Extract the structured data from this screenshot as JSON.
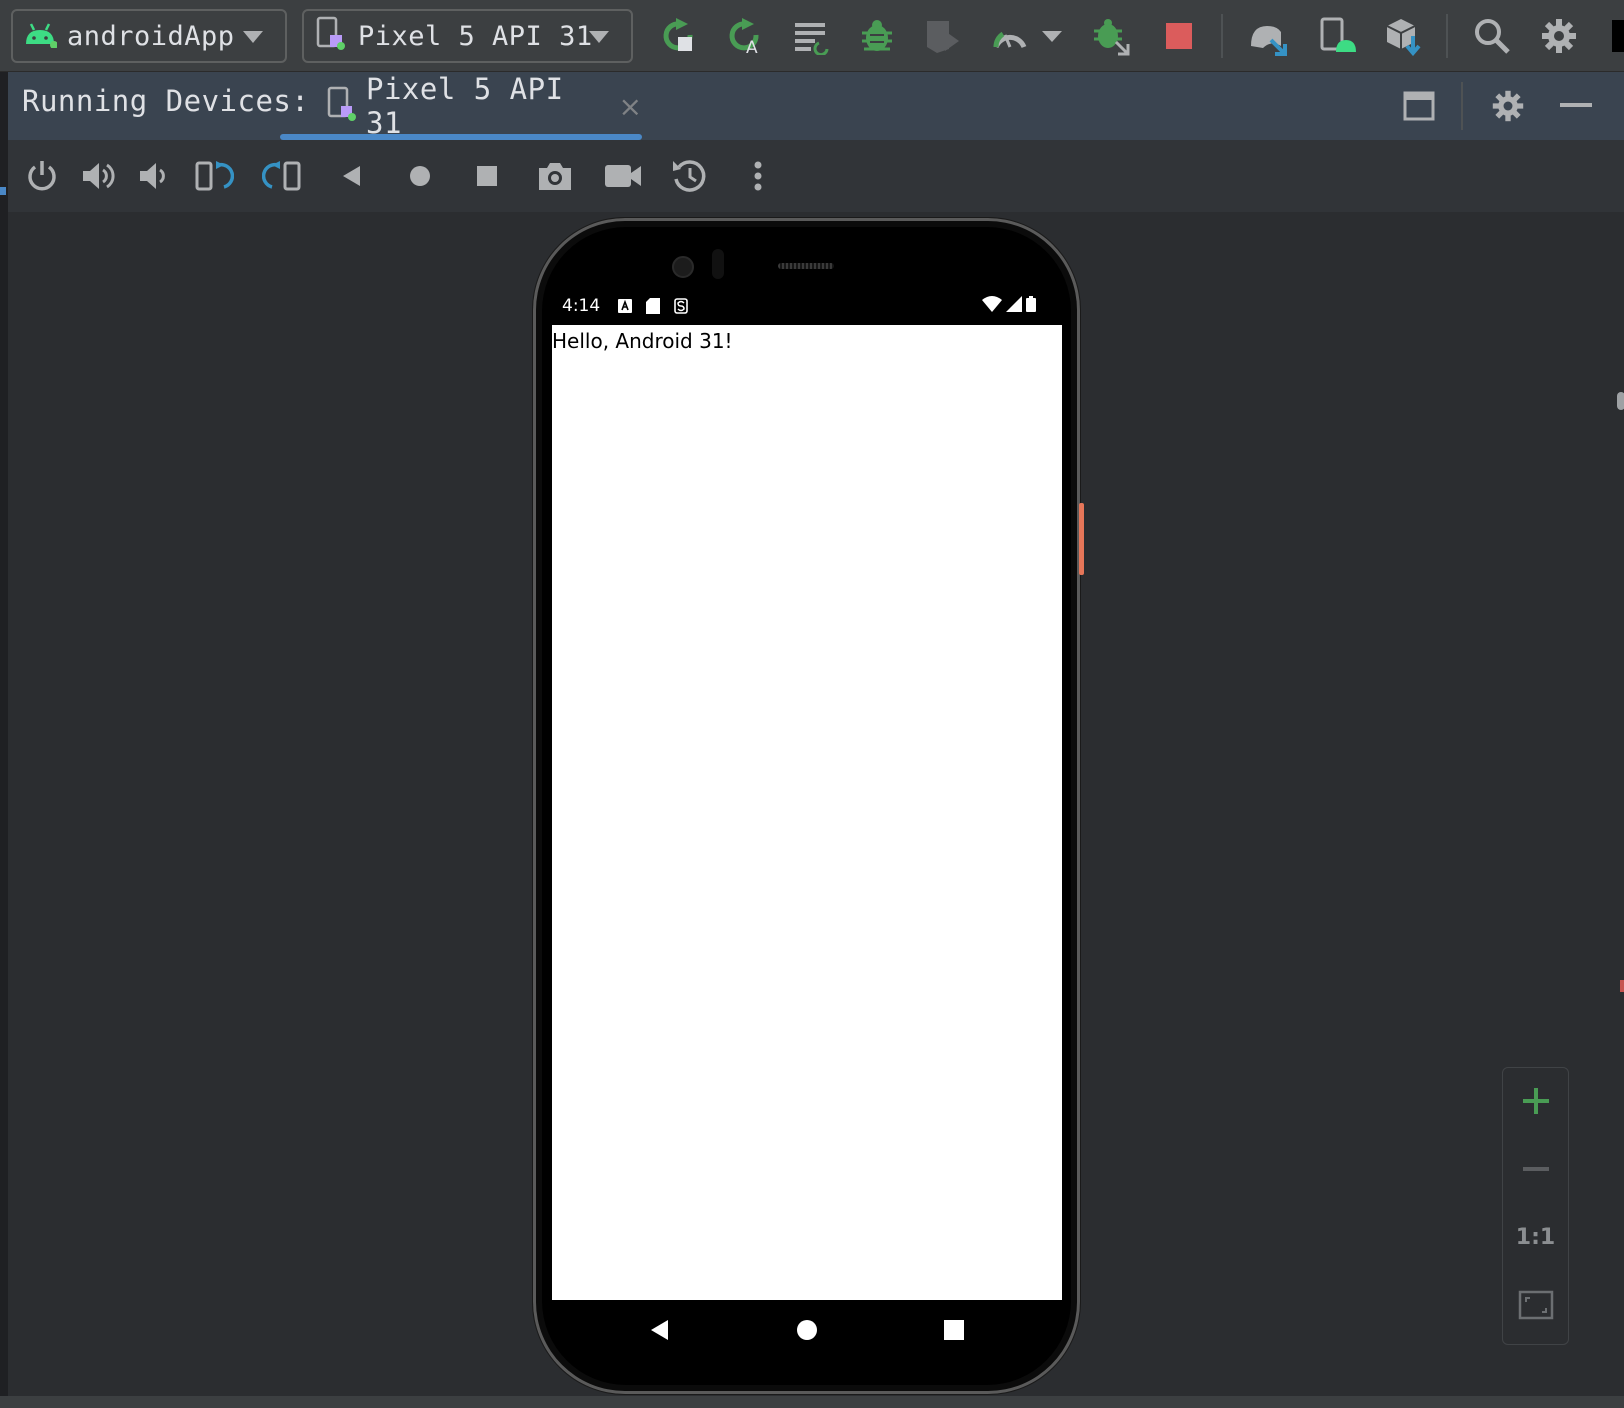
{
  "toolbar": {
    "run_config": "androidApp",
    "device_selector": "Pixel 5 API 31",
    "icons": [
      "run-icon",
      "apply-changes-icon",
      "apply-code-changes-icon",
      "debug-icon",
      "coverage-icon",
      "profile-icon",
      "attach-debugger-icon",
      "stop-icon",
      "sync-gradle-icon",
      "device-manager-icon",
      "sdk-manager-icon",
      "search-icon",
      "settings-icon"
    ],
    "colors": {
      "run_green": "#499c54",
      "stop_red": "#db5c5c",
      "blue": "#3592c4"
    }
  },
  "running_devices": {
    "title": "Running Devices:",
    "tab_label": "Pixel 5 API 31",
    "close_glyph": "×",
    "accent": "#4a88c7"
  },
  "device_toolbar": {
    "icons": [
      "power-icon",
      "volume-up-icon",
      "volume-down-icon",
      "rotate-left-icon",
      "rotate-right-icon",
      "back-icon",
      "home-icon",
      "overview-icon",
      "screenshot-icon",
      "screen-record-icon",
      "snapshot-icon",
      "more-icon"
    ]
  },
  "device": {
    "status_time": "4:14",
    "app_text": "Hello, Android 31!"
  },
  "zoom": {
    "plus": "+",
    "minus": "−",
    "actual_size": "1:1"
  }
}
